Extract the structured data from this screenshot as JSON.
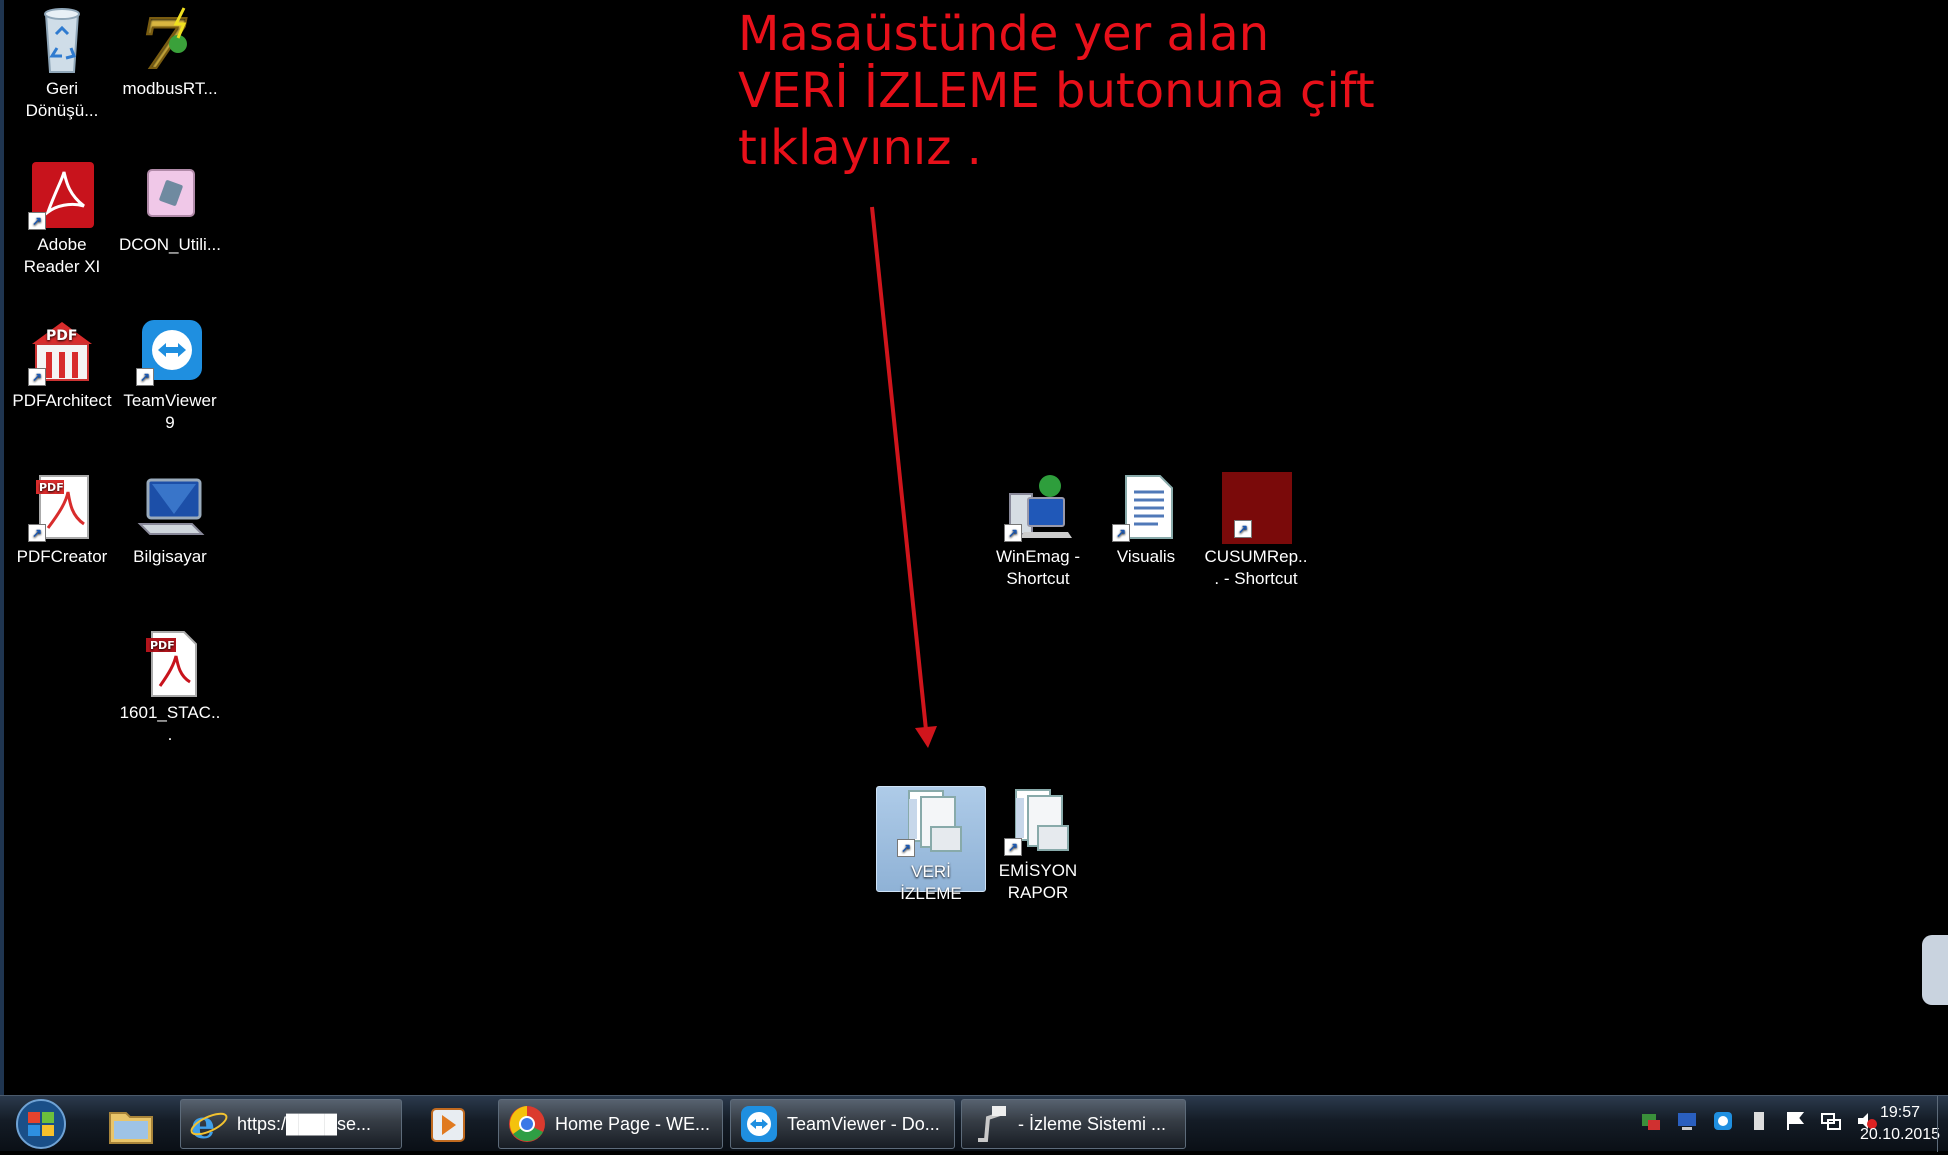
{
  "annotation": {
    "text": "Masaüstünde yer alan\nVERİ İZLEME butonuna çift\ntıklayınız .",
    "color": "#e8101a"
  },
  "desktop_icons": [
    {
      "label": "Geri Dönüşü...",
      "icon": "recycle-bin-icon"
    },
    {
      "label": "modbusRT...",
      "icon": "modbus-icon"
    },
    {
      "label": "Adobe Reader XI",
      "icon": "adobe-reader-icon"
    },
    {
      "label": "DCON_Utili...",
      "icon": "dcon-utility-icon"
    },
    {
      "label": "PDFArchitect",
      "icon": "pdf-architect-icon"
    },
    {
      "label": "TeamViewer 9",
      "icon": "teamviewer-icon"
    },
    {
      "label": "PDFCreator",
      "icon": "pdf-creator-icon"
    },
    {
      "label": "Bilgisayar",
      "icon": "computer-icon"
    },
    {
      "label": "1601_STAC...",
      "icon": "pdf-file-icon"
    },
    {
      "label": "WinEmag - Shortcut",
      "icon": "winemag-icon"
    },
    {
      "label": "Visualis",
      "icon": "document-icon"
    },
    {
      "label": "CUSUMRep... - Shortcut",
      "icon": "cusum-icon"
    },
    {
      "label": "VERİ İZLEME",
      "icon": "veri-izleme-icon",
      "selected": true
    },
    {
      "label": "EMİSYON RAPOR",
      "icon": "emisyon-rapor-icon"
    }
  ],
  "taskbar": {
    "buttons": [
      {
        "label": "https:/████se...",
        "icon": "internet-explorer-icon"
      },
      {
        "label": "Home Page - WE...",
        "icon": "chrome-icon"
      },
      {
        "label": "TeamViewer - Do...",
        "icon": "teamviewer-icon"
      },
      {
        "label": "- İzleme Sistemi   ...",
        "icon": "app-icon"
      }
    ],
    "clock_time": "19:57",
    "clock_date": "20.10.2015"
  }
}
